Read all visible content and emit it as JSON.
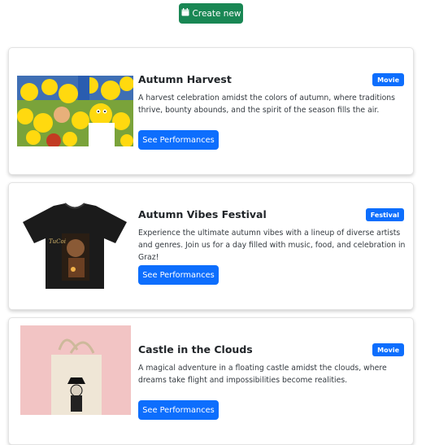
{
  "toolbar": {
    "create_label": "Create new"
  },
  "events": [
    {
      "title": "Autumn Harvest",
      "category": "Movie",
      "description": "A harvest celebration amidst the colors of autumn, where traditions thrive, bounty abounds, and the spirit of the season fills the air.",
      "button_label": "See Performances"
    },
    {
      "title": "Autumn Vibes Festival",
      "category": "Festival",
      "description": "Experience the ultimate autumn vibes with a lineup of diverse artists and genres. Join us for a day filled with music, food, and celebration in Graz!",
      "button_label": "See Performances"
    },
    {
      "title": "Castle in the Clouds",
      "category": "Movie",
      "description": "A magical adventure in a floating castle amidst the clouds, where dreams take flight and impossibilities become realities.",
      "button_label": "See Performances"
    }
  ],
  "colors": {
    "success": "#198754",
    "primary": "#0d6efd"
  },
  "icons": {
    "create": "calendar-icon"
  }
}
